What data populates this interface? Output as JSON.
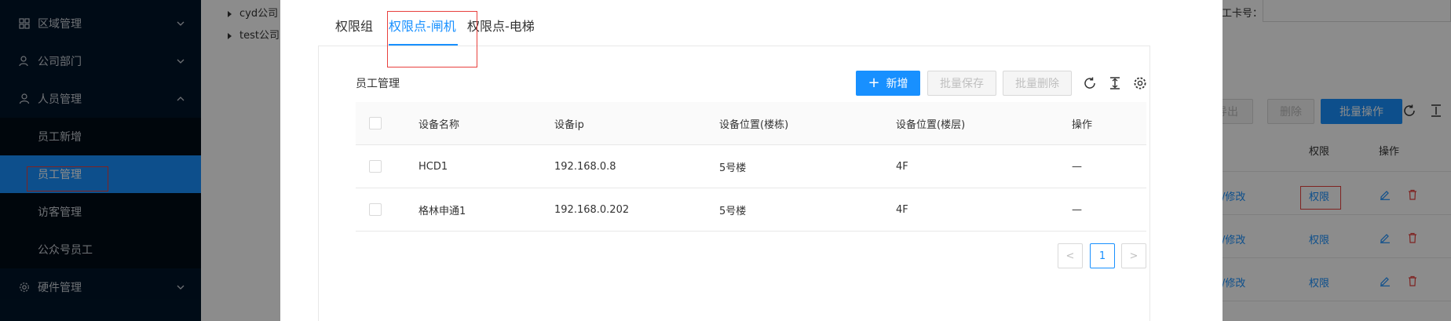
{
  "sidebar": {
    "groups": [
      {
        "label": "区域管理",
        "icon": "area-icon"
      },
      {
        "label": "公司部门",
        "icon": "department-icon"
      },
      {
        "label": "人员管理",
        "icon": "user-icon"
      },
      {
        "label": "硬件管理",
        "icon": "hardware-icon"
      }
    ],
    "personnel_items": [
      {
        "label": "员工新增"
      },
      {
        "label": "员工管理"
      },
      {
        "label": "访客管理"
      },
      {
        "label": "公众号员工"
      }
    ]
  },
  "tree": {
    "nodes": [
      {
        "label": "cyd公司"
      },
      {
        "label": "test公司"
      }
    ]
  },
  "background": {
    "card_no_label": "工卡号：",
    "buttons": {
      "export": "导出",
      "delete": "删除",
      "batch": "批量操作"
    },
    "columns": {
      "permission": "权限",
      "action": "操作"
    },
    "rows": [
      {
        "modify": "/修改",
        "permission": "权限"
      },
      {
        "modify": "/修改",
        "permission": "权限"
      },
      {
        "modify": "/修改",
        "permission": "权限"
      }
    ]
  },
  "modal": {
    "tabs": [
      {
        "label": "权限组",
        "active": false
      },
      {
        "label": "权限点-闸机",
        "active": true
      },
      {
        "label": "权限点-电梯",
        "active": false
      }
    ],
    "card_title": "员工管理",
    "toolbar": {
      "add_label": "新增",
      "batch_save_label": "批量保存",
      "batch_delete_label": "批量删除"
    },
    "table": {
      "columns": [
        "设备名称",
        "设备ip",
        "设备位置(楼栋)",
        "设备位置(楼层)",
        "操作"
      ],
      "rows": [
        {
          "name": "HCD1",
          "ip": "192.168.0.8",
          "building": "5号楼",
          "floor": "4F",
          "action": "—"
        },
        {
          "name": "格林申通1",
          "ip": "192.168.0.202",
          "building": "5号楼",
          "floor": "4F",
          "action": "—"
        }
      ]
    },
    "pagination": {
      "current": "1",
      "prev": "<",
      "next": ">"
    }
  },
  "colors": {
    "primary": "#1890ff",
    "highlight_red": "#e8403d",
    "sidebar_bg": "#001529"
  }
}
